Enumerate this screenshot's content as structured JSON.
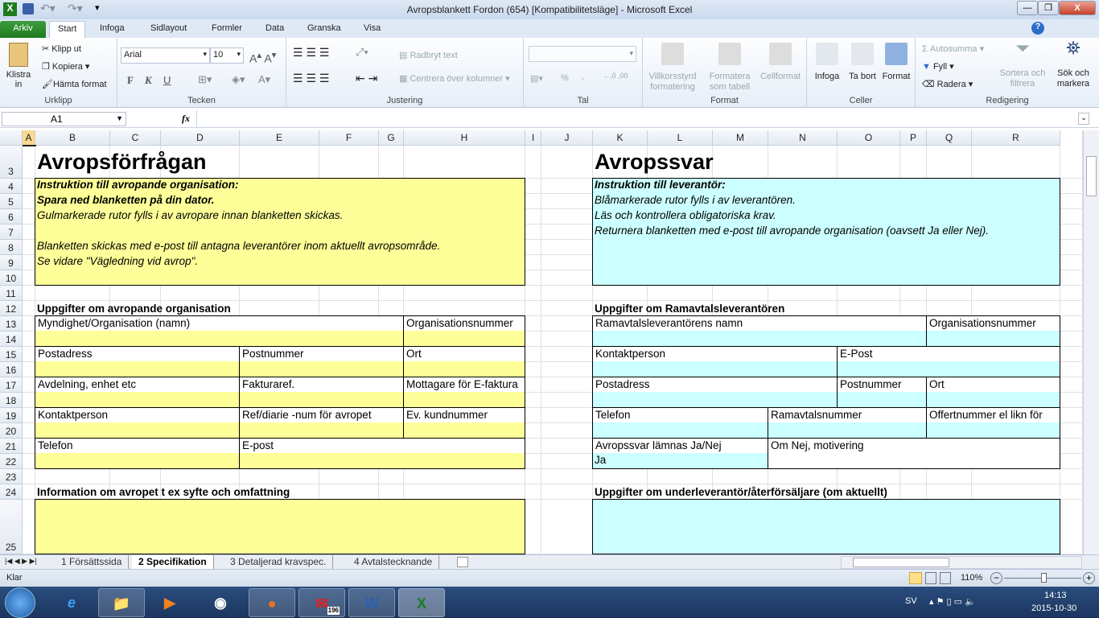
{
  "window": {
    "title": "Avropsblankett Fordon (654)  [Kompatibilitetsläge]  -  Microsoft Excel",
    "minimize": "—",
    "restore": "❐",
    "close": "X"
  },
  "tabs": [
    "Arkiv",
    "Start",
    "Infoga",
    "Sidlayout",
    "Formler",
    "Data",
    "Granska",
    "Visa"
  ],
  "ribbon": {
    "clipboard": {
      "paste": "Klistra in",
      "cut": "Klipp ut",
      "copy": "Kopiera",
      "format_painter": "Hämta format",
      "label": "Urklipp"
    },
    "font": {
      "name": "Arial",
      "size": "10",
      "bold": "F",
      "italic": "K",
      "underline": "U",
      "label": "Tecken"
    },
    "alignment": {
      "wrap": "Radbryt text",
      "merge": "Centrera över kolumner",
      "label": "Justering"
    },
    "number": {
      "format": "",
      "percent": "%",
      "comma": ",",
      "label": "Tal"
    },
    "styles": {
      "conditional": "Villkorsstyrd formatering",
      "as_table": "Formatera som tabell",
      "cell_styles": "Cellformat",
      "label": "Format"
    },
    "cells": {
      "insert": "Infoga",
      "delete": "Ta bort",
      "format": "Format",
      "label": "Celler"
    },
    "editing": {
      "autosum": "Autosumma",
      "fill": "Fyll",
      "clear": "Radera",
      "sort": "Sortera och filtrera",
      "find": "Sök och markera",
      "label": "Redigering"
    }
  },
  "formula_bar": {
    "name_box": "A1",
    "fx": "fx",
    "formula": ""
  },
  "columns": [
    "A",
    "B",
    "C",
    "D",
    "E",
    "F",
    "G",
    "H",
    "I",
    "J",
    "K",
    "L",
    "M",
    "N",
    "O",
    "P",
    "Q",
    "R"
  ],
  "rows": [
    "3",
    "4",
    "5",
    "6",
    "7",
    "8",
    "9",
    "10",
    "11",
    "12",
    "13",
    "14",
    "15",
    "16",
    "17",
    "18",
    "19",
    "20",
    "21",
    "22",
    "23",
    "24",
    "25"
  ],
  "sheet": {
    "left_title": "Avropsförfrågan",
    "right_title": "Avropssvar",
    "left_instructions": [
      "Instruktion till avropande organisation:",
      "Spara ned blanketten på din dator.",
      "Gulmarkerade rutor fylls i av avropare innan blanketten skickas.",
      "",
      "Blanketten skickas med e-post till antagna leverantörer inom aktuellt avropsområde.",
      "Se vidare \"Vägledning vid avrop\"."
    ],
    "right_instructions": [
      "Instruktion till leverantör:",
      "Blåmarkerade rutor fylls i av leverantören.",
      "Läs och kontrollera obligatoriska krav.",
      "Returnera blanketten med e-post till avropande organisation (oavsett Ja eller Nej)."
    ],
    "left_section": "Uppgifter om avropande organisation",
    "right_section": "Uppgifter om Ramavtalsleverantören",
    "left_fields": [
      "Myndighet/Organisation (namn)",
      "Organisationsnummer",
      "Postadress",
      "Postnummer",
      "Ort",
      "Avdelning, enhet etc",
      "Fakturaref.",
      "Mottagare för E-faktura",
      "Kontaktperson",
      "Ref/diarie -num för avropet",
      "Ev. kundnummer",
      "Telefon",
      "E-post"
    ],
    "right_fields": [
      "Ramavtalsleverantörens namn",
      "Organisationsnummer",
      "Kontaktperson",
      "E-Post",
      "Postadress",
      "Postnummer",
      "Ort",
      "Telefon",
      "Ramavtalsnummer",
      "Offertnummer el likn för",
      "Avropssvar lämnas Ja/Nej",
      "Om Nej, motivering"
    ],
    "answer_value": "Ja",
    "left_info": "Information om avropet t ex syfte och omfattning",
    "right_info": "Uppgifter om underleverantör/återförsäljare (om aktuellt)"
  },
  "sheet_tabs": [
    "1 Försättssida",
    "2 Specifikation",
    "3 Detaljerad kravspec.",
    "4 Avtalstecknande"
  ],
  "active_sheet": "2 Specifikation",
  "status": {
    "ready": "Klar",
    "zoom": "110%",
    "zoom_level": 110
  },
  "taskbar": {
    "lang": "SV",
    "time": "14:13",
    "date": "2015-10-30",
    "mail_badge": "196"
  },
  "colors": {
    "yellow": "#ffff99",
    "cyan": "#ccffff",
    "excel_green": "#1e7b1e"
  }
}
